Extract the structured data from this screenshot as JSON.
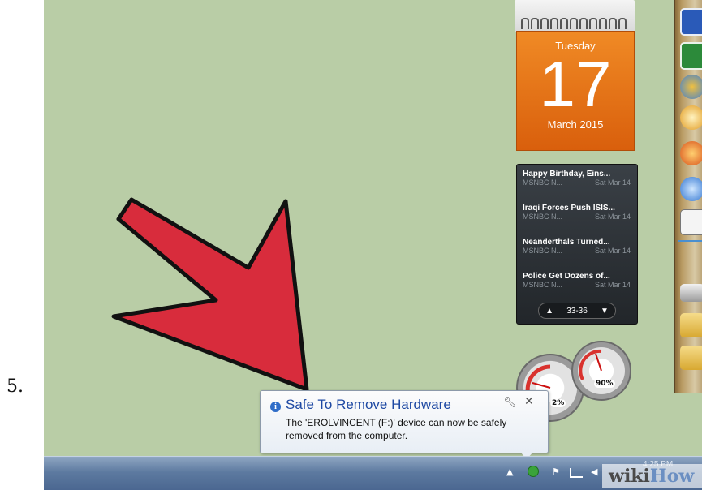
{
  "step": {
    "number": "5."
  },
  "calendar": {
    "weekday": "Tuesday",
    "date": "17",
    "month_year": "March 2015"
  },
  "news": {
    "items": [
      {
        "title": "Happy Birthday, Eins...",
        "source": "MSNBC N...",
        "date": "Sat Mar 14"
      },
      {
        "title": "Iraqi Forces Push ISIS...",
        "source": "MSNBC N...",
        "date": "Sat Mar 14"
      },
      {
        "title": "Neanderthals Turned...",
        "source": "MSNBC N...",
        "date": "Sat Mar 14"
      },
      {
        "title": "Police Get Dozens of...",
        "source": "MSNBC N...",
        "date": "Sat Mar 14"
      }
    ],
    "pager": {
      "prev_icon": "▲",
      "range": "33-36",
      "next_icon": "▼"
    }
  },
  "meters": {
    "cpu_label": "2%",
    "mem_label": "90%"
  },
  "balloon": {
    "title": "Safe To Remove Hardware",
    "body": "The 'EROLVINCENT (F:)' device can now be safely removed from the computer.",
    "options_icon": "wrench-icon",
    "close_icon": "close-icon"
  },
  "taskbar": {
    "clock": "4:25 PM"
  },
  "watermark": {
    "part1": "wiki",
    "part2": "How"
  },
  "launcher": {
    "icons": [
      "word-icon",
      "excel-icon",
      "network-icon",
      "search-icon",
      "firefox-icon",
      "itunes-icon",
      "calendar-icon",
      "drive-icon",
      "folder-icon",
      "folder-icon"
    ]
  },
  "colors": {
    "desktop": "#b9cda6",
    "calendar_orange": "#e8731a",
    "arrow_red": "#d82c3c",
    "balloon_title": "#1e49a3",
    "taskbar": "#5d7aa0"
  }
}
